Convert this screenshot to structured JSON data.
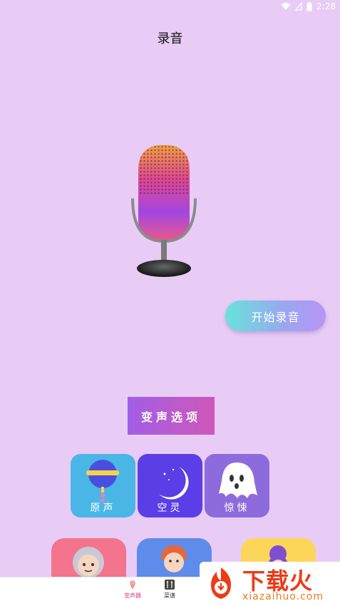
{
  "status_bar": {
    "time": "2:28",
    "icons": [
      "wifi-icon",
      "signal-icon",
      "battery-icon"
    ]
  },
  "header": {
    "title": "录音"
  },
  "recorder": {
    "mic_icon": "microphone-icon",
    "start_label": "开始录音"
  },
  "options": {
    "label": "变声选项"
  },
  "effects_row1": [
    {
      "label": "原声",
      "icon": "lollipop-icon",
      "color": "#4ab6e5"
    },
    {
      "label": "空灵",
      "icon": "moon-icon",
      "color": "#5b3ee6"
    },
    {
      "label": "惊悚",
      "icon": "ghost-icon",
      "color": "#8e6bdc"
    }
  ],
  "effects_row2": [
    {
      "icon": "elder-avatar-icon",
      "color": "#f4738d"
    },
    {
      "icon": "bearded-man-icon",
      "color": "#5d8cea"
    },
    {
      "icon": "girl-avatar-icon",
      "color": "#fcd659"
    }
  ],
  "tabbar": {
    "tabs": [
      {
        "label": "变声器",
        "icon": "ice-cream-icon",
        "active": true,
        "color": "#e23b8a"
      },
      {
        "label": "菜谱",
        "icon": "utensils-icon",
        "active": false,
        "color": "#333333"
      }
    ]
  },
  "watermark": {
    "text": "下载火",
    "url": "xiazaihuo.com",
    "icon": "flame-logo-icon"
  }
}
